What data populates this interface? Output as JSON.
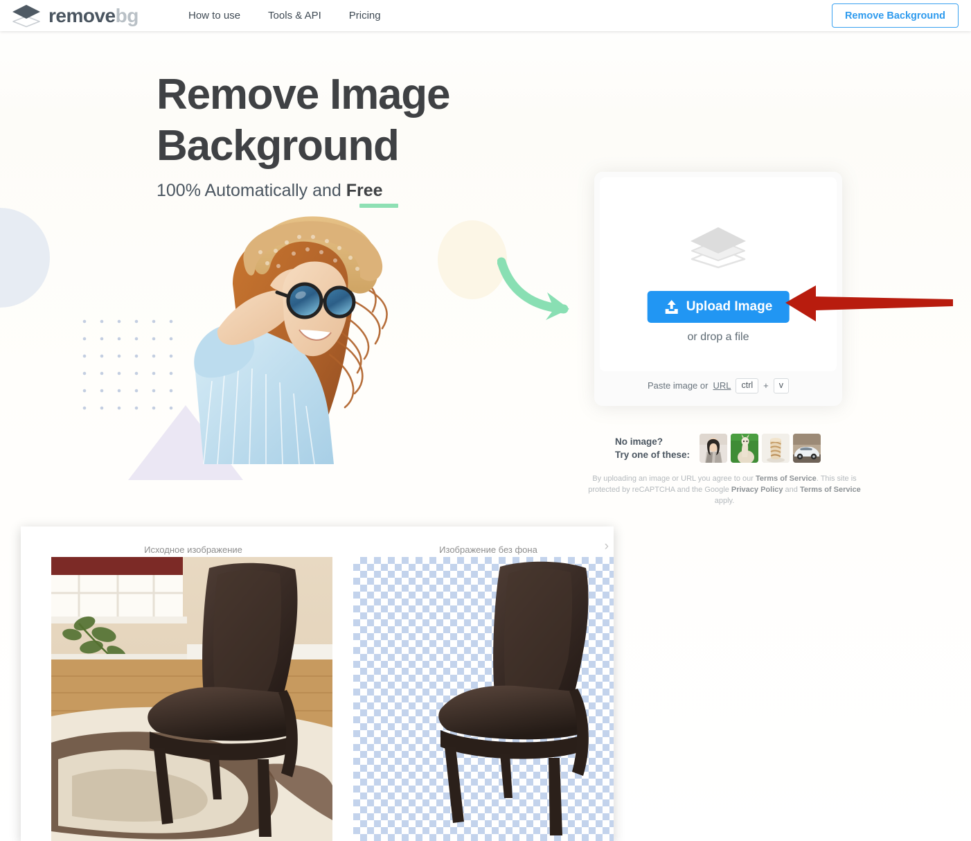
{
  "header": {
    "logo": {
      "name_dark": "remove",
      "name_grey": "bg",
      "icon": "layers-stack-icon"
    },
    "nav": [
      {
        "label": "How to use"
      },
      {
        "label": "Tools & API"
      },
      {
        "label": "Pricing"
      }
    ],
    "cta_label": "Remove Background",
    "cta_color": "#2f9bee"
  },
  "hero": {
    "title": "Remove Image Background",
    "subtitle_prefix": "100% Automatically and ",
    "subtitle_emphasis": "Free",
    "underline_color": "#8ee0b4",
    "photo_alt": "woman-in-straw-hat-and-sunglasses"
  },
  "upload": {
    "stack_icon": "layers-stack-icon",
    "button_label": "Upload Image",
    "button_icon": "upload-icon",
    "button_color": "#2196f3",
    "drop_text": "or drop a file",
    "paste_prefix": "Paste image or",
    "paste_link": "URL",
    "key_ctrl": "ctrl",
    "key_plus": "+",
    "key_v": "v"
  },
  "samples": {
    "line1": "No image?",
    "line2": "Try one of these:",
    "thumbs": [
      {
        "name": "woman-portrait-thumbnail"
      },
      {
        "name": "alpaca-thumbnail"
      },
      {
        "name": "pastry-cake-thumbnail"
      },
      {
        "name": "white-sports-car-thumbnail"
      }
    ]
  },
  "legal": {
    "part1": "By uploading an image or URL you agree to our ",
    "tos1": "Terms of Service",
    "part2": ". This site is protected by reCAPTCHA and the Google ",
    "privacy": "Privacy Policy",
    "part3": " and ",
    "tos2": "Terms of Service",
    "part4": " apply."
  },
  "result_panel": {
    "caption_original": "Исходное изображение",
    "caption_removed": "Изображение без фона",
    "next_icon": "chevron-right-icon",
    "original_alt": "brown-leather-dining-chair-in-room",
    "removed_alt": "brown-leather-dining-chair-transparent"
  },
  "annotations": {
    "red_arrow": {
      "name": "red-pointer-arrow",
      "color": "#b81c0e",
      "points_to": "Upload Image"
    },
    "green_arrow": {
      "name": "green-curved-arrow",
      "color": "#89dfb3"
    }
  }
}
